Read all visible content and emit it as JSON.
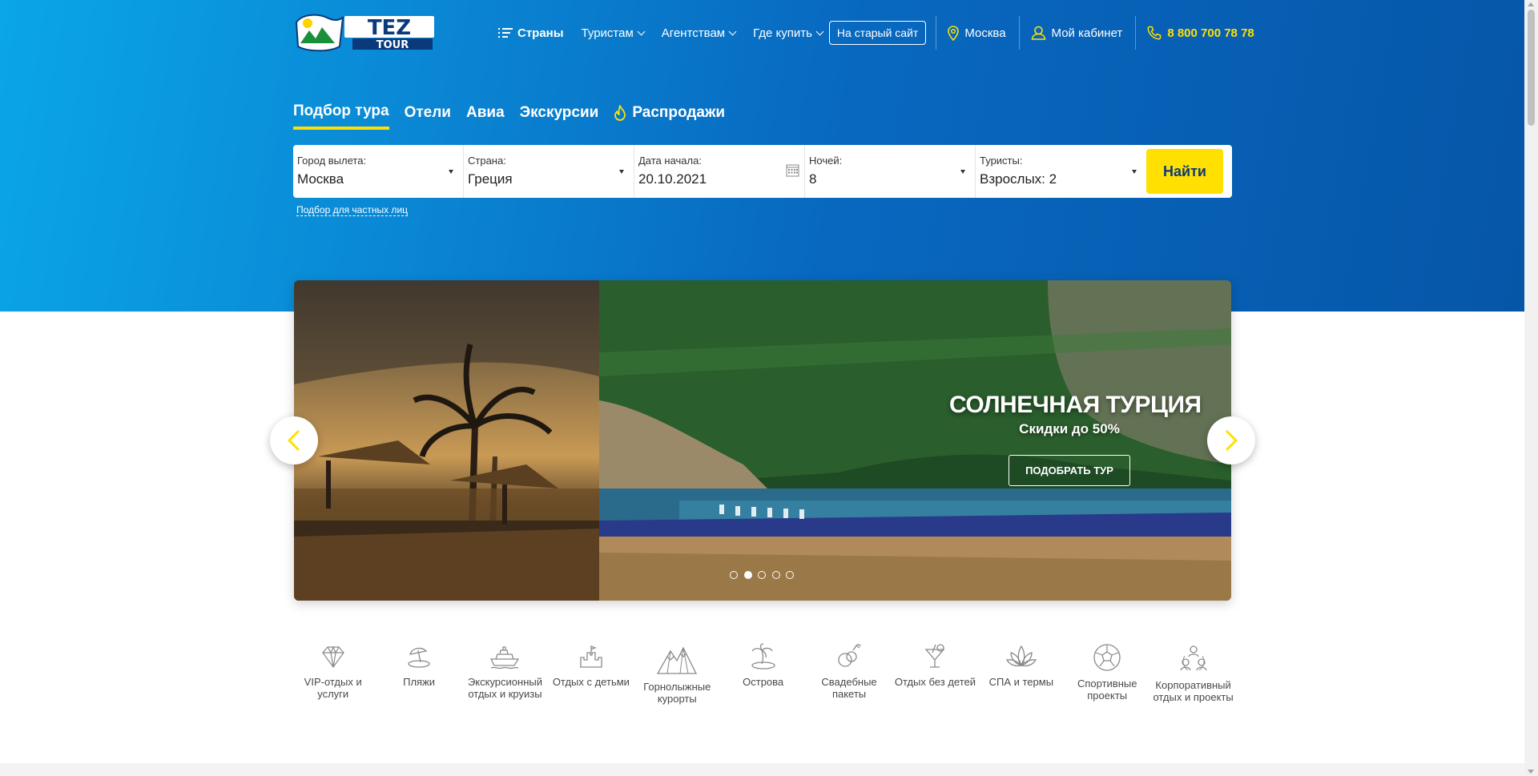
{
  "colors": {
    "accent": "#ffe000",
    "hero_start": "#0aa6e6",
    "hero_end": "#0656a8",
    "icon_gray": "#8a8a8a"
  },
  "brand": {
    "logo_text_top": "TEZ",
    "logo_text_bottom": "TOUR"
  },
  "nav": {
    "countries": "Страны",
    "tourists": "Туристам",
    "agencies": "Агентствам",
    "where_to_buy": "Где купить",
    "old_site": "На старый сайт",
    "city": "Москва",
    "cabinet": "Мой кабинет",
    "phone": "8 800 700 78 78"
  },
  "tabs": [
    "Подбор тура",
    "Отели",
    "Авиа",
    "Экскурсии",
    "Распродажи"
  ],
  "search": {
    "departure_label": "Город вылета:",
    "departure_value": "Москва",
    "country_label": "Страна:",
    "country_value": "Греция",
    "date_label": "Дата начала:",
    "date_value": "20.10.2021",
    "nights_label": "Ночей:",
    "nights_value": "8",
    "tourists_label": "Туристы:",
    "tourists_value": "Взрослых: 2",
    "find_button": "Найти",
    "private_link": "Подбор для частных лиц"
  },
  "slider": {
    "title": "СОЛНЕЧНАЯ ТУРЦИЯ",
    "subtitle": "Скидки до 50%",
    "button": "ПОДОБРАТЬ ТУР",
    "total_slides": 5,
    "active_slide": 2
  },
  "categories": [
    {
      "icon": "diamond-icon",
      "label": "VIP-отдых и услуги"
    },
    {
      "icon": "beach-umbrella-icon",
      "label": "Пляжи"
    },
    {
      "icon": "cruise-ship-icon",
      "label": "Экскурсионный отдых и круизы"
    },
    {
      "icon": "sandcastle-icon",
      "label": "Отдых с детьми"
    },
    {
      "icon": "mountains-icon",
      "label": "Горнолыжные курорты"
    },
    {
      "icon": "island-icon",
      "label": "Острова"
    },
    {
      "icon": "wedding-rings-icon",
      "label": "Свадебные пакеты"
    },
    {
      "icon": "cocktail-icon",
      "label": "Отдых без детей"
    },
    {
      "icon": "lotus-icon",
      "label": "СПА и термы"
    },
    {
      "icon": "soccer-ball-icon",
      "label": "Спортивные проекты"
    },
    {
      "icon": "team-icon",
      "label": "Корпоративный отдых и проекты"
    }
  ]
}
